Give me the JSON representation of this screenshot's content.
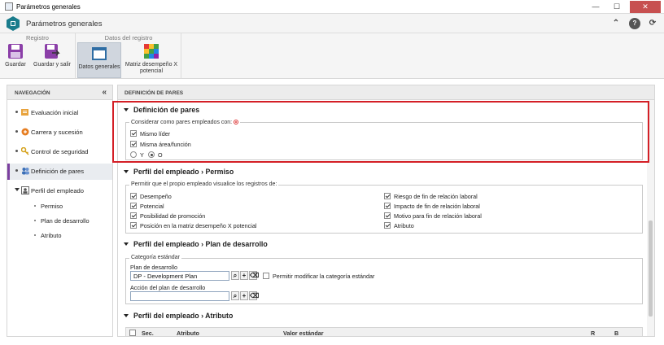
{
  "window": {
    "title": "Parámetros generales",
    "minimize": "—",
    "maximize": "☐",
    "close": "✕"
  },
  "app": {
    "title": "Parámetros generales"
  },
  "ribbon": {
    "groups": [
      "Registro",
      "Datos del registro"
    ],
    "buttons": {
      "save": "Guardar",
      "save_exit": "Guardar y salir",
      "general_data": "Datos generales",
      "matrix_1": "Matriz desempeño X",
      "matrix_2": "potencial"
    }
  },
  "nav": {
    "heading": "NAVEGACIÓN",
    "items": [
      "Evaluación inicial",
      "Carrera y sucesión",
      "Control de seguridad",
      "Definición de pares",
      "Perfil del empleado"
    ],
    "subitems": [
      "Permiso",
      "Plan de desarrollo",
      "Atributo"
    ]
  },
  "main": {
    "heading": "DEFINICIÓN DE PARES",
    "peers": {
      "title": "Definición de pares",
      "legend": "Considerar como pares empleados con:",
      "options": [
        "Mismo líder",
        "Misma área/función"
      ],
      "radio_y": "Y",
      "radio_o": "O"
    },
    "permission": {
      "title": "Perfil del empleado › Permiso",
      "legend": "Permitir que el propio empleado visualice los registros de:",
      "left": [
        "Desempeño",
        "Potencial",
        "Posibilidad de promoción",
        "Posición en la matriz desempeño X potencial"
      ],
      "right": [
        "Riesgo de fin de relación laboral",
        "Impacto de fin de relación laboral",
        "Motivo para fin de relación laboral",
        "Atributo"
      ]
    },
    "plan": {
      "title": "Perfil del empleado › Plan de desarrollo",
      "legend": "Categoría estándar",
      "plan_label": "Plan de desarrollo",
      "plan_value": "DP - Development Plan",
      "allow_modify": "Permitir modificar la categoría estándar",
      "action_label": "Acción del plan de desarrollo",
      "action_value": ""
    },
    "attribute": {
      "title": "Perfil del empleado › Atributo",
      "columns": [
        "Sec.",
        "Atributo",
        "Valor estándar",
        "R",
        "B"
      ]
    }
  },
  "colors": {
    "accent": "#7b3fa0",
    "highlight": "#d41f26",
    "logo": "#1a7c8c"
  }
}
